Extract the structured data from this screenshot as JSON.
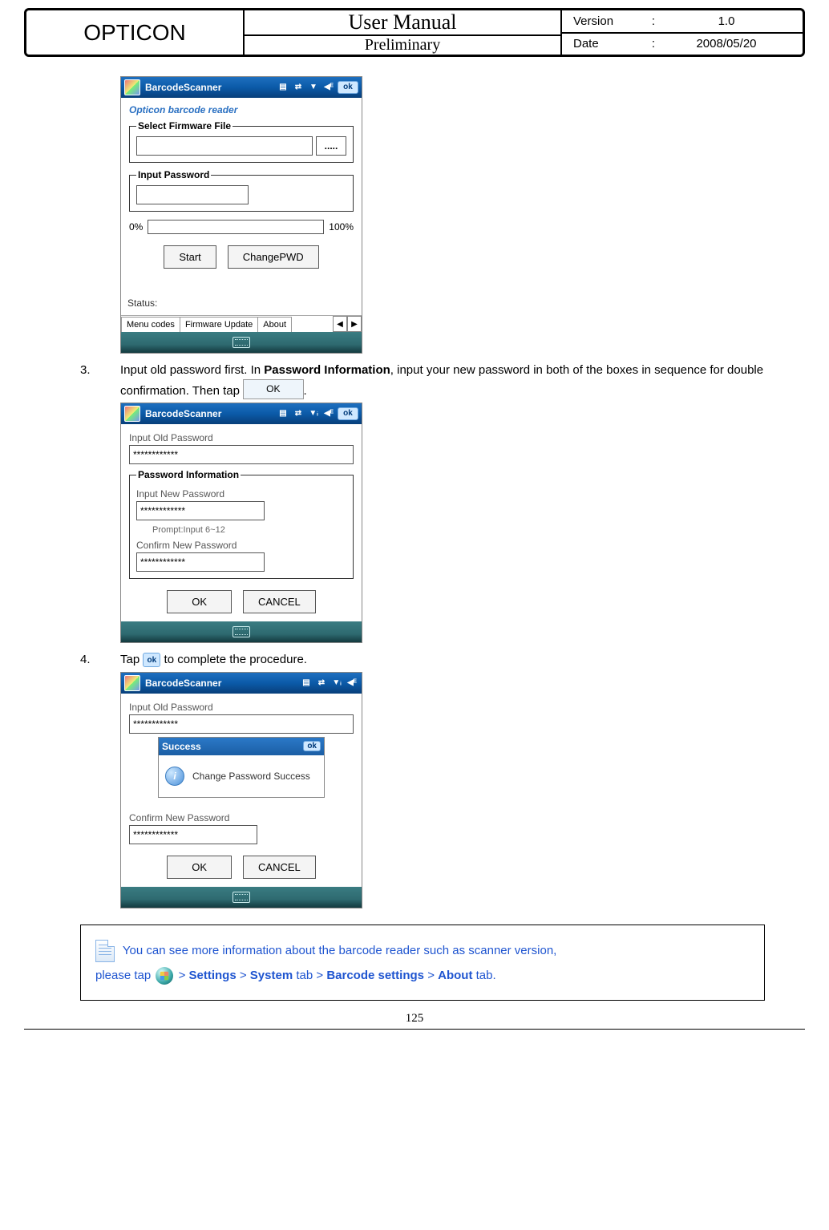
{
  "header": {
    "brand": "OPTICON",
    "title": "User Manual",
    "subtitle": "Preliminary",
    "version_label": "Version",
    "version_sep": ":",
    "version_value": "1.0",
    "date_label": "Date",
    "date_sep": ":",
    "date_value": "2008/05/20"
  },
  "screenshot1": {
    "title": "BarcodeScanner",
    "ok": "ok",
    "banner": "Opticon barcode reader",
    "legend_file": "Select Firmware File",
    "browse_label": ".....",
    "legend_pwd": "Input Password",
    "pct0": "0%",
    "pct100": "100%",
    "btn_start": "Start",
    "btn_change": "ChangePWD",
    "status_label": "Status:",
    "tab1": "Menu codes",
    "tab2": "Firmware Update",
    "tab3": "About",
    "arrow_l": "◀",
    "arrow_r": "▶"
  },
  "step3": {
    "num": "3.",
    "t1": "Input old password first. In ",
    "t2": "Password Information",
    "t3": ", input your new password in both of the boxes in sequence for double confirmation. Then tap ",
    "ok_btn": "OK",
    "t4": "."
  },
  "screenshot2": {
    "title": "BarcodeScanner",
    "ok": "ok",
    "lbl_old": "Input Old Password",
    "val_old": "************",
    "legend_info": "Password Information",
    "lbl_new": "Input New Password",
    "val_new": "************",
    "prompt": "Prompt:Input 6~12",
    "lbl_confirm": "Confirm New Password",
    "val_confirm": "************",
    "btn_ok": "OK",
    "btn_cancel": "CANCEL"
  },
  "step4": {
    "num": "4.",
    "t1": "Tap ",
    "ok_small": "ok",
    "t2": " to complete the procedure."
  },
  "screenshot3": {
    "title": "BarcodeScanner",
    "lbl_old": "Input Old Password",
    "val_old": "************",
    "dlg_title": "Success",
    "dlg_ok": "ok",
    "dlg_msg": "Change Password Success",
    "lbl_confirm": "Confirm New Password",
    "val_confirm": "************",
    "btn_ok": "OK",
    "btn_cancel": "CANCEL"
  },
  "note": {
    "line1a": " You can see more information about the barcode reader such as scanner version, ",
    "line2a": "please tap ",
    "sep": " > ",
    "p1": "Settings",
    "p2": "System",
    "p2suf": " tab",
    "p3": "Barcode settings",
    "p4": "About",
    "p4suf": " tab."
  },
  "page_number": "125"
}
